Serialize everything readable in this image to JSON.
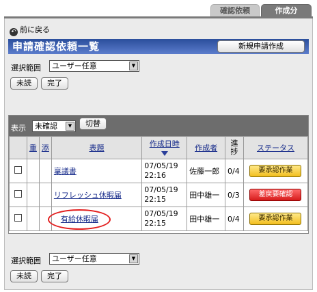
{
  "tabs": [
    "確認依頼",
    "作成分"
  ],
  "back_label": "前に戻る",
  "page_title": "申請確認依頼一覧",
  "new_button": "新規申請作成",
  "range_label": "選択範囲",
  "range_value": "ユーザー任意",
  "btn_unread": "未読",
  "btn_done": "完了",
  "display_label": "表示",
  "display_value": "未確認",
  "toggle_button": "切替",
  "columns": {
    "priority": "重",
    "attach": "添",
    "subject": "表題",
    "created": "作成日時",
    "author": "作成者",
    "progress": "進捗",
    "status": "ステータス"
  },
  "rows": [
    {
      "subject": "稟議書",
      "date": "07/05/19",
      "time": "22:16",
      "author": "佐藤一郎",
      "progress": "0/4",
      "status": "要承認作業",
      "status_color": "#f2be1e"
    },
    {
      "subject": "リフレッシュ休暇届",
      "date": "07/05/19",
      "time": "22:15",
      "author": "田中雄一",
      "progress": "0/3",
      "status": "差戻要確認",
      "status_color": "#d61c1c"
    },
    {
      "subject": "有給休暇届",
      "date": "07/05/19",
      "time": "22:15",
      "author": "田中雄一",
      "progress": "0/4",
      "status": "要承認作業",
      "status_color": "#f2be1e"
    }
  ],
  "bottom": {
    "range_label": "選択範囲",
    "range_value": "ユーザー任意",
    "btn_unread": "未読",
    "btn_done": "完了"
  }
}
